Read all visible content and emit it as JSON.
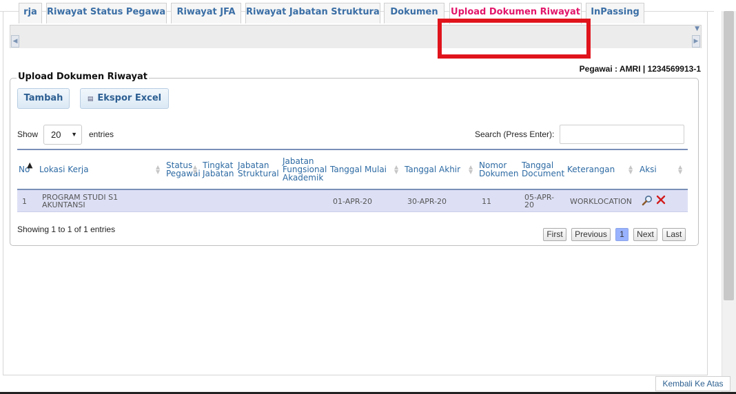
{
  "tabs": [
    {
      "label": "rja",
      "active": false
    },
    {
      "label": "Riwayat Status Pegawai",
      "active": false
    },
    {
      "label": "Riwayat JFA",
      "active": false
    },
    {
      "label": "Riwayat Jabatan Struktural",
      "active": false
    },
    {
      "label": "Dokumen",
      "active": false
    },
    {
      "label": "Upload Dokumen Riwayat",
      "active": true
    },
    {
      "label": "InPassing",
      "active": false
    }
  ],
  "employee": {
    "label": "Pegawai : AMRI | 1234569913-1"
  },
  "panel": {
    "legend": "Upload Dokumen Riwayat"
  },
  "toolbar": {
    "add_label": "Tambah",
    "export_label": "Ekspor Excel"
  },
  "length_menu": {
    "show_label": "Show",
    "value": "20",
    "entries_label": "entries"
  },
  "search": {
    "label": "Search (Press Enter):",
    "value": ""
  },
  "table": {
    "columns": [
      "No",
      "Lokasi Kerja",
      "Status Pegawai",
      "Tingkat Jabatan",
      "Jabatan Struktural",
      "Jabatan Fungsional Akademik",
      "Tanggal Mulai",
      "Tanggal Akhir",
      "Nomor Dokumen",
      "Tanggal Document",
      "Keterangan",
      "Aksi"
    ],
    "column_lines": {
      "status": [
        "Status",
        "Pegawai"
      ],
      "tingkat": [
        "Tingkat",
        "Jabatan"
      ],
      "jabstruk": [
        "Jabatan",
        "Struktural"
      ],
      "jfa": [
        "Jabatan",
        "Fungsional",
        "Akademik"
      ],
      "nomor": [
        "Nomor",
        "Dokumen"
      ],
      "tgldoc": [
        "Tanggal",
        "Document"
      ]
    },
    "rows": [
      {
        "no": "1",
        "lokasi": [
          "PROGRAM STUDI S1",
          "AKUNTANSI"
        ],
        "status": "",
        "tingkat": "",
        "jabstruk": "",
        "jfa": "",
        "mulai": "01-APR-20",
        "akhir": "30-APR-20",
        "nomor": "11",
        "tgldoc": [
          "05-APR-",
          "20"
        ],
        "keterangan": "WORKLOCATION"
      }
    ]
  },
  "info": {
    "text": "Showing 1 to 1 of 1 entries"
  },
  "pagination": {
    "first": "First",
    "previous": "Previous",
    "current": "1",
    "next": "Next",
    "last": "Last"
  },
  "footer": {
    "back_to_top": "Kembali Ke Atas"
  },
  "colors": {
    "active_tab": "#e2166a",
    "highlight": "#e0141c",
    "link": "#3a6ea5",
    "row_bg": "#dde0f5"
  }
}
